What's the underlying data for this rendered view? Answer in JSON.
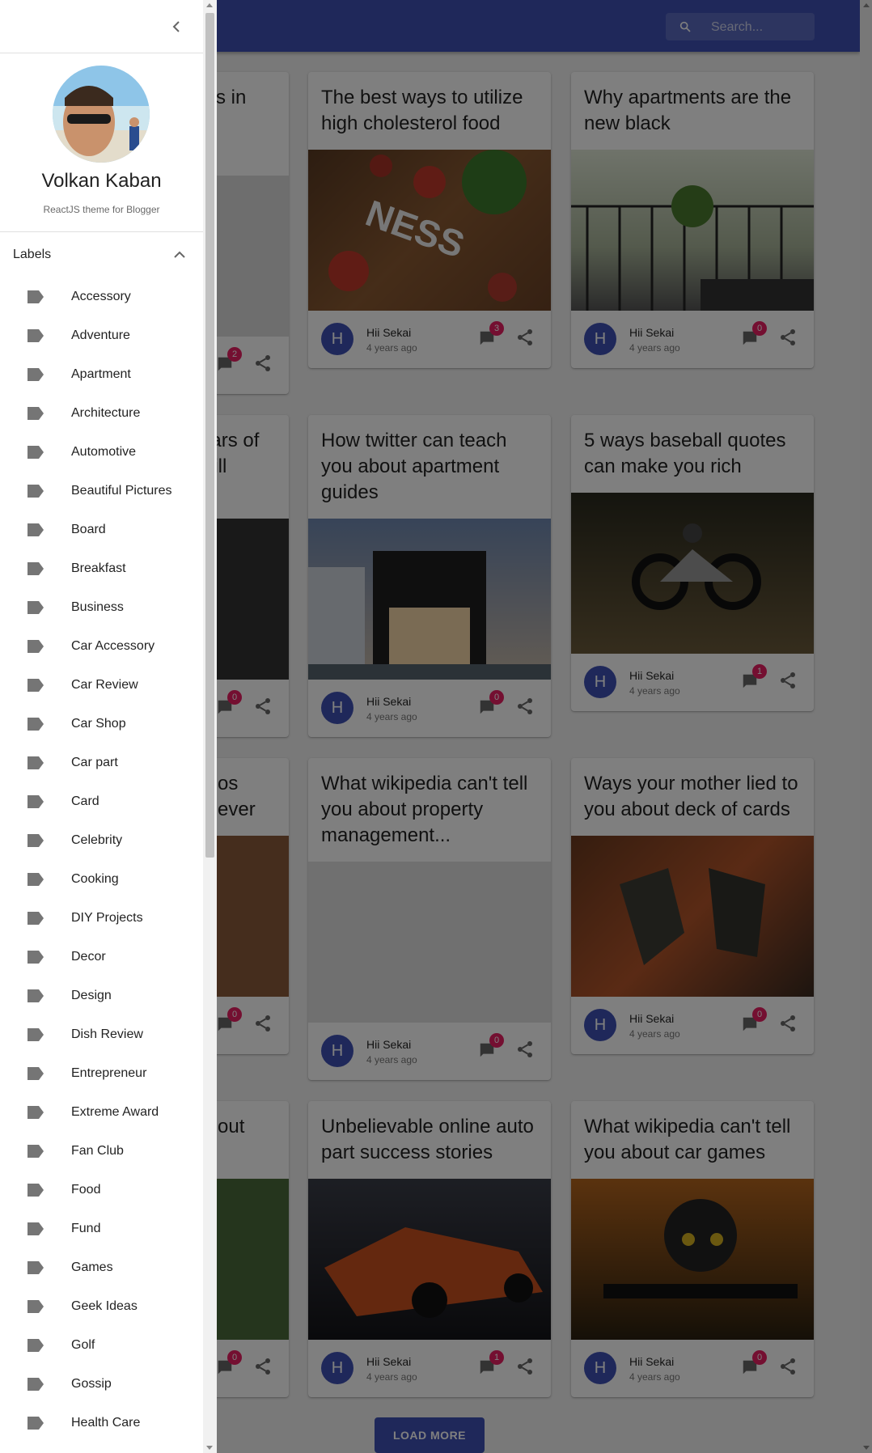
{
  "search": {
    "placeholder": "Search..."
  },
  "cards": [
    {
      "title": "",
      "tail": "s in",
      "author": "",
      "time": "",
      "comments": "2"
    },
    {
      "title": "The best ways to utilize high cholesterol food",
      "author": "Hii Sekai",
      "time": "4 years ago",
      "comments": "3",
      "avatar": "H"
    },
    {
      "title": "Why apartments are the new black",
      "author": "Hii Sekai",
      "time": "4 years ago",
      "comments": "0",
      "avatar": "H"
    },
    {
      "tail": "ears of will",
      "comments": "0"
    },
    {
      "title": "How twitter can teach you about apartment guides",
      "author": "Hii Sekai",
      "time": "4 years ago",
      "comments": "0",
      "avatar": "H"
    },
    {
      "title": "5 ways baseball quotes can make you rich",
      "author": "Hii Sekai",
      "time": "4 years ago",
      "comments": "1",
      "avatar": "H"
    },
    {
      "tail": "os ever",
      "comments": "0"
    },
    {
      "title": "What wikipedia can't tell you about property management...",
      "author": "Hii Sekai",
      "time": "4 years ago",
      "comments": "0",
      "avatar": "H"
    },
    {
      "title": "Ways your mother lied to you about deck of cards",
      "author": "Hii Sekai",
      "time": "4 years ago",
      "comments": "0",
      "avatar": "H"
    },
    {
      "tail": "out",
      "comments": "0"
    },
    {
      "title": "Unbelievable online auto part success stories",
      "author": "Hii Sekai",
      "time": "4 years ago",
      "comments": "1",
      "avatar": "H"
    },
    {
      "title": "What wikipedia can't tell you about car games",
      "author": "Hii Sekai",
      "time": "4 years ago",
      "comments": "0",
      "avatar": "H"
    }
  ],
  "load_more": "LOAD MORE",
  "drawer": {
    "name": "Volkan Kaban",
    "subtitle": "ReactJS theme for Blogger",
    "labels_title": "Labels",
    "labels": [
      "Accessory",
      "Adventure",
      "Apartment",
      "Architecture",
      "Automotive",
      "Beautiful Pictures",
      "Board",
      "Breakfast",
      "Business",
      "Car Accessory",
      "Car Review",
      "Car Shop",
      "Car part",
      "Card",
      "Celebrity",
      "Cooking",
      "DIY Projects",
      "Decor",
      "Design",
      "Dish Review",
      "Entrepreneur",
      "Extreme Award",
      "Fan Club",
      "Food",
      "Fund",
      "Games",
      "Geek Ideas",
      "Golf",
      "Gossip",
      "Health Care"
    ]
  },
  "colors": {
    "primary": "#3f51b5",
    "badge": "#e91e63"
  }
}
